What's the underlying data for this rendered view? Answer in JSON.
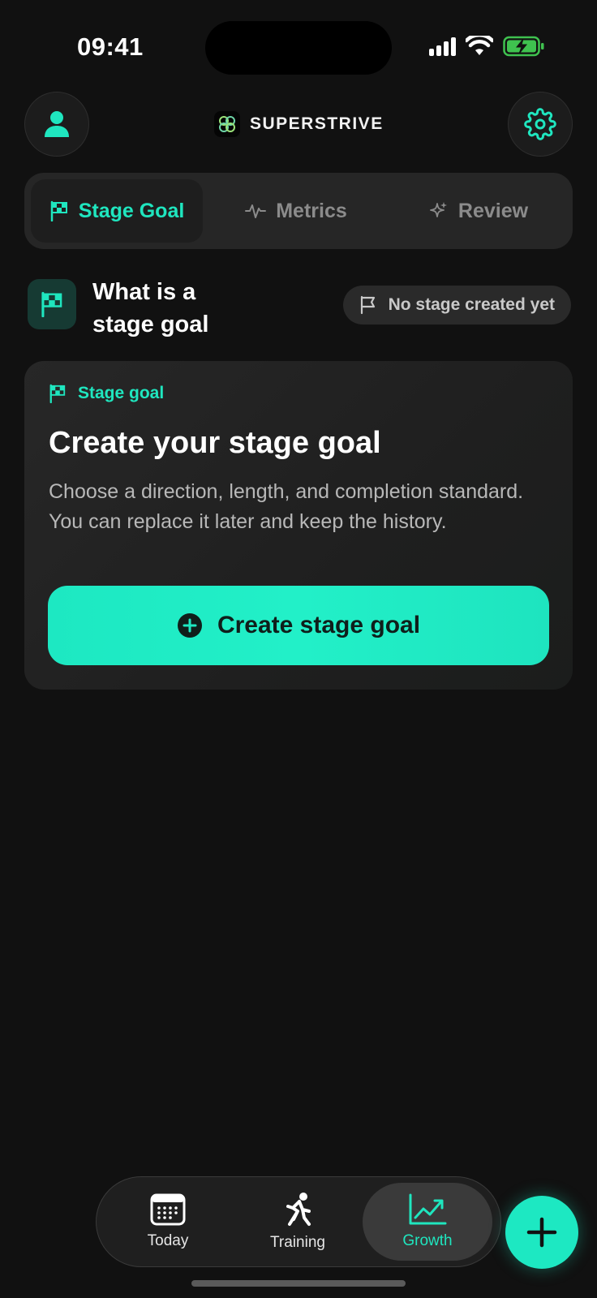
{
  "status_bar": {
    "time": "09:41"
  },
  "header": {
    "brand_name": "SUPERSTRIVE",
    "profile_icon": "person-icon",
    "settings_icon": "gear-icon"
  },
  "tabs": [
    {
      "label": "Stage Goal",
      "icon": "checkered-flag-icon",
      "active": true
    },
    {
      "label": "Metrics",
      "icon": "pulse-icon",
      "active": false
    },
    {
      "label": "Review",
      "icon": "sparkle-icon",
      "active": false
    }
  ],
  "info": {
    "title": "What is a stage goal",
    "status_pill": "No stage created yet"
  },
  "card": {
    "label": "Stage goal",
    "title": "Create your stage goal",
    "description": "Choose a direction, length, and completion standard. You can replace it later and keep the history.",
    "button_label": "Create stage goal"
  },
  "bottom_nav": [
    {
      "label": "Today",
      "icon": "calendar-icon",
      "active": false
    },
    {
      "label": "Training",
      "icon": "running-person-icon",
      "active": false
    },
    {
      "label": "Growth",
      "icon": "trending-chart-icon",
      "active": true
    }
  ],
  "fab_icon": "plus-icon",
  "colors": {
    "accent": "#1fe6bf",
    "background": "#111111",
    "surface": "#262626"
  }
}
